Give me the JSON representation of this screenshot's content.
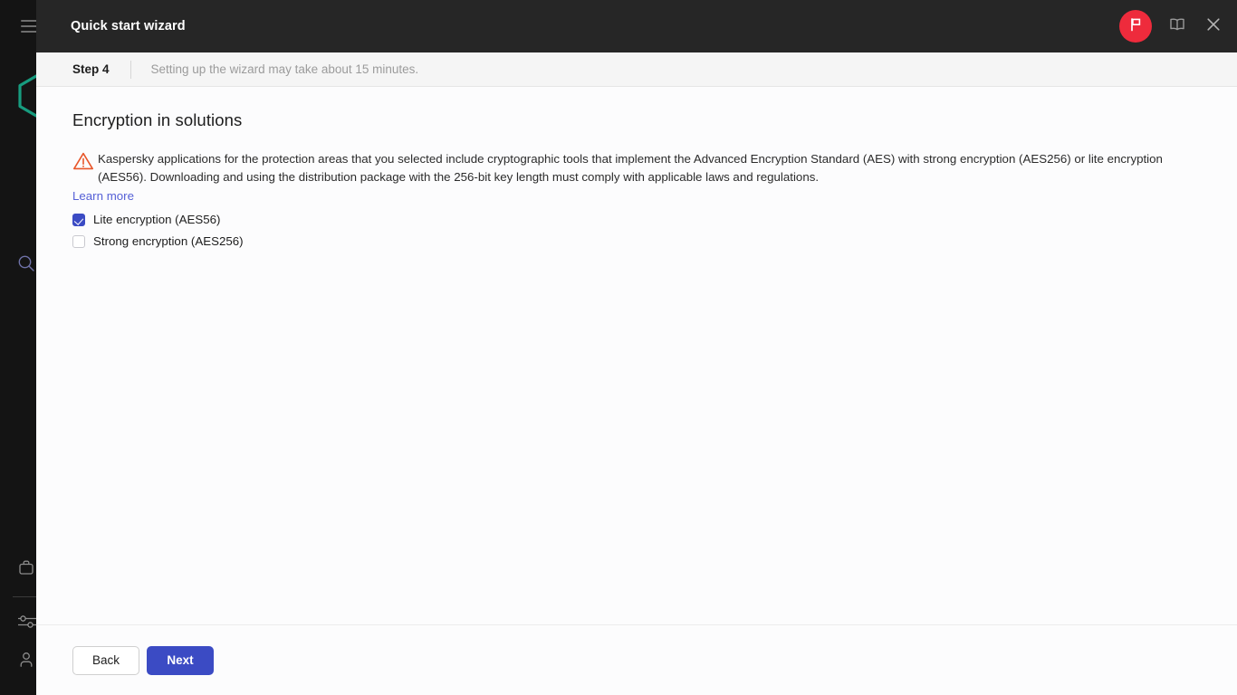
{
  "colors": {
    "sidebar_bg": "#141414",
    "titlebar_bg": "#262626",
    "accent_blue": "#3b4bc4",
    "link_blue": "#5560d6",
    "badge_red": "#ee2b3c",
    "warning_orange": "#e8562a",
    "brand_teal": "#179c7f",
    "stepbar_bg": "#f5f5f5",
    "content_bg": "#fcfcfd"
  },
  "sidebar": {
    "menu_toggle": "hamburger-menu",
    "logo": "kaspersky-hexagon-logo",
    "items": [
      {
        "icon": "search-icon",
        "name": "search"
      },
      {
        "icon": "briefcase-icon",
        "name": "assets"
      },
      {
        "icon": "sliders-icon",
        "name": "settings"
      },
      {
        "icon": "user-icon",
        "name": "account"
      }
    ]
  },
  "titlebar": {
    "title": "Quick start wizard",
    "actions": [
      {
        "icon": "flag-icon",
        "name": "notifications-flag-badge"
      },
      {
        "icon": "book-icon",
        "name": "help-documentation"
      },
      {
        "icon": "close-icon",
        "name": "close-window"
      }
    ]
  },
  "stepbar": {
    "step_label": "Step 4",
    "hint": "Setting up the wizard may take about 15 minutes."
  },
  "main": {
    "page_title": "Encryption in solutions",
    "notice": {
      "icon": "warning-triangle-icon",
      "text": "Kaspersky applications for the protection areas that you selected include cryptographic tools that implement the Advanced Encryption Standard (AES) with strong encryption (AES256) or lite encryption (AES56). Downloading and using the distribution package with the 256-bit key length must comply with applicable laws and regulations."
    },
    "learn_more_label": "Learn more",
    "options": [
      {
        "label": "Lite encryption (AES56)",
        "checked": true
      },
      {
        "label": "Strong encryption (AES256)",
        "checked": false
      }
    ]
  },
  "footer": {
    "back_label": "Back",
    "next_label": "Next"
  }
}
